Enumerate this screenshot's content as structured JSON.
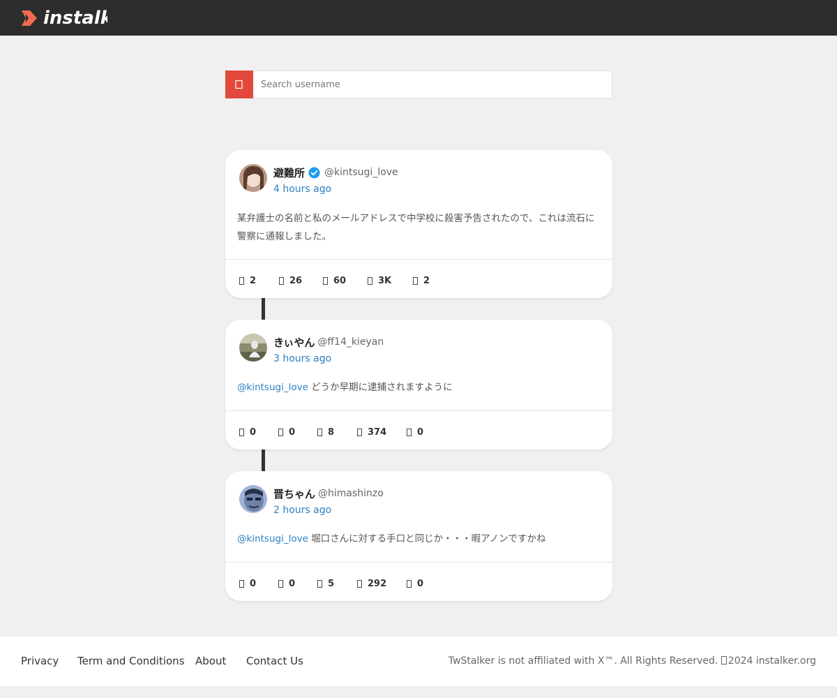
{
  "header": {
    "logo_text": "instalker",
    "logo_icon": "play-chevron-icon",
    "brand_color": "#f26b50"
  },
  "search": {
    "placeholder": "Search username",
    "icon": "search-icon",
    "button_color": "#e2493a"
  },
  "posts": [
    {
      "display_name": "避難所",
      "verified": true,
      "handle": "@kintsugi_love",
      "time": "4 hours ago",
      "mention": "",
      "text": "某弁護士の名前と私のメールアドレスで中学校に殺害予告されたので、これは流石に警察に通報しました。",
      "stats": [
        "2",
        "26",
        "60",
        "3K",
        "2"
      ]
    },
    {
      "display_name": "きぃやん",
      "verified": false,
      "handle": "@ff14_kieyan",
      "time": "3 hours ago",
      "mention": "@kintsugi_love",
      "text": "どうか早期に逮捕されますように",
      "stats": [
        "0",
        "0",
        "8",
        "374",
        "0"
      ]
    },
    {
      "display_name": "晋ちゃん",
      "verified": false,
      "handle": "@himashinzo",
      "time": "2 hours ago",
      "mention": "@kintsugi_love",
      "text": "堀口さんに対する手口と同じか・・・暇アノンですかね",
      "stats": [
        "0",
        "0",
        "5",
        "292",
        "0"
      ]
    }
  ],
  "footer": {
    "links": [
      "Privacy",
      "Term and Conditions",
      "About",
      "Contact Us"
    ],
    "copyright_prefix": "TwStalker is not affiliated with X™. All Rights Reserved.",
    "copyright_suffix": "2024 instalker.org"
  }
}
